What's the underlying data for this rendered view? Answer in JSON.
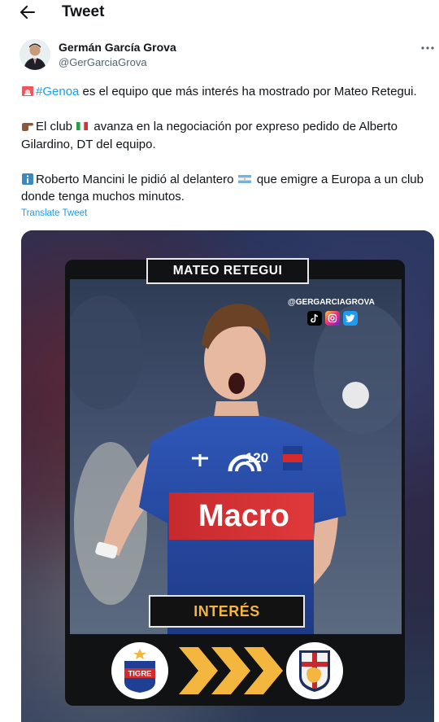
{
  "header": {
    "title": "Tweet",
    "back_icon": "arrow-left-icon"
  },
  "author": {
    "name": "Germán García Grova",
    "handle": "@GerGarciaGrova",
    "more_icon": "more-horizontal-icon"
  },
  "tweet": {
    "para1": {
      "hashtag": "#Genoa",
      "text": " es el equipo que más interés ha mostrado por Mateo Retegui.",
      "emoji": "rotating-light-emoji"
    },
    "para2": {
      "text_before_flag": "El club ",
      "text_after_flag": " avanza en la negociación por expreso pedido de Alberto Gilardino, DT del equipo.",
      "emoji": "pointing-right-emoji",
      "flag": "italy-flag-emoji"
    },
    "para3": {
      "text_before_flag": "Roberto Mancini le pidió al delantero ",
      "text_after_flag": " que emigre a Europa a un club donde tenga muchos minutos.",
      "emoji": "information-emoji",
      "flag": "argentina-flag-emoji"
    },
    "translate_label": "Translate Tweet"
  },
  "media": {
    "player_name": "MATEO RETEGUI",
    "handle_overlay": "@GERGARCIAGROVA",
    "social_icons": [
      "tiktok-icon",
      "instagram-icon",
      "twitter-icon"
    ],
    "status_label": "INTERÉS",
    "shirt_sponsor": "Macro",
    "shirt_badge": "120",
    "from_club": "TIGRE",
    "to_club": "genoa-crest",
    "colors": {
      "accent_gold": "#f3b63f",
      "twitter_blue": "#1d9bf0",
      "tigre_blue": "#1f3f94",
      "tigre_red": "#d42b2b"
    }
  }
}
